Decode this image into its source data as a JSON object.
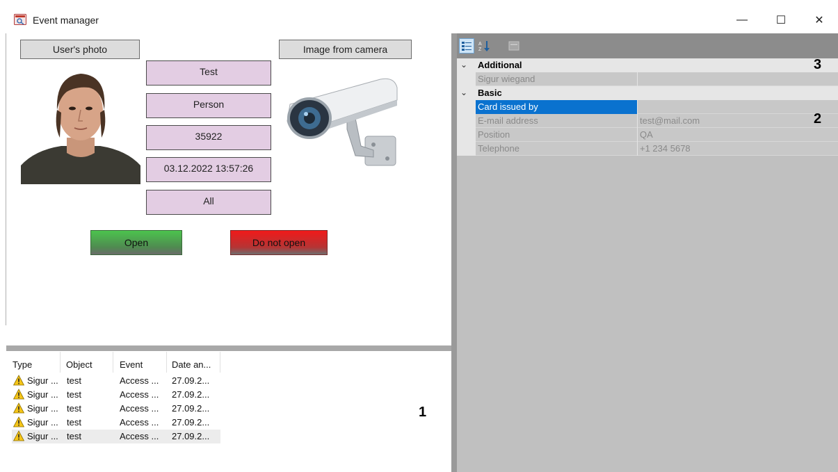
{
  "window": {
    "title": "Event manager",
    "controls": {
      "minimize": "—",
      "maximize": "☐",
      "close": "✕"
    }
  },
  "panel": {
    "user_photo_label": "User's photo",
    "camera_label": "Image from camera",
    "info_fields": [
      "Test",
      "Person",
      "35922",
      "03.12.2022 13:57:26",
      "All"
    ],
    "open_label": "Open",
    "do_not_open_label": "Do not open"
  },
  "event_list": {
    "columns": [
      "Type",
      "Object",
      "Event",
      "Date an..."
    ],
    "rows": [
      {
        "type": "Sigur ...",
        "object": "test",
        "event": "Access ...",
        "date": "27.09.2..."
      },
      {
        "type": "Sigur ...",
        "object": "test",
        "event": "Access ...",
        "date": "27.09.2..."
      },
      {
        "type": "Sigur ...",
        "object": "test",
        "event": "Access ...",
        "date": "27.09.2..."
      },
      {
        "type": "Sigur ...",
        "object": "test",
        "event": "Access ...",
        "date": "27.09.2..."
      },
      {
        "type": "Sigur ...",
        "object": "test",
        "event": "Access ...",
        "date": "27.09.2..."
      }
    ],
    "selected_row": 4,
    "marker": "1"
  },
  "property_grid": {
    "toolbar_icons": [
      "categorized-icon",
      "alphabetical-sort-icon",
      "property-pages-icon"
    ],
    "categories": [
      {
        "name": "Additional",
        "marker": "3",
        "props": [
          {
            "name": "Sigur wiegand",
            "value": ""
          }
        ]
      },
      {
        "name": "Basic",
        "marker": "2",
        "props": [
          {
            "name": "Card issued by",
            "value": ""
          },
          {
            "name": "E-mail address",
            "value": "test@mail.com"
          },
          {
            "name": "Position",
            "value": "QA"
          },
          {
            "name": "Telephone",
            "value": "+1 234 5678"
          }
        ]
      }
    ],
    "selected_property": "Card issued by"
  },
  "colors": {
    "info_box": "#e3cde3",
    "open_green": "#4cc34e",
    "do_not_open_red": "#f01a1a",
    "selection_blue": "#0a72cf",
    "grid_gray": "#c0c0c0"
  }
}
